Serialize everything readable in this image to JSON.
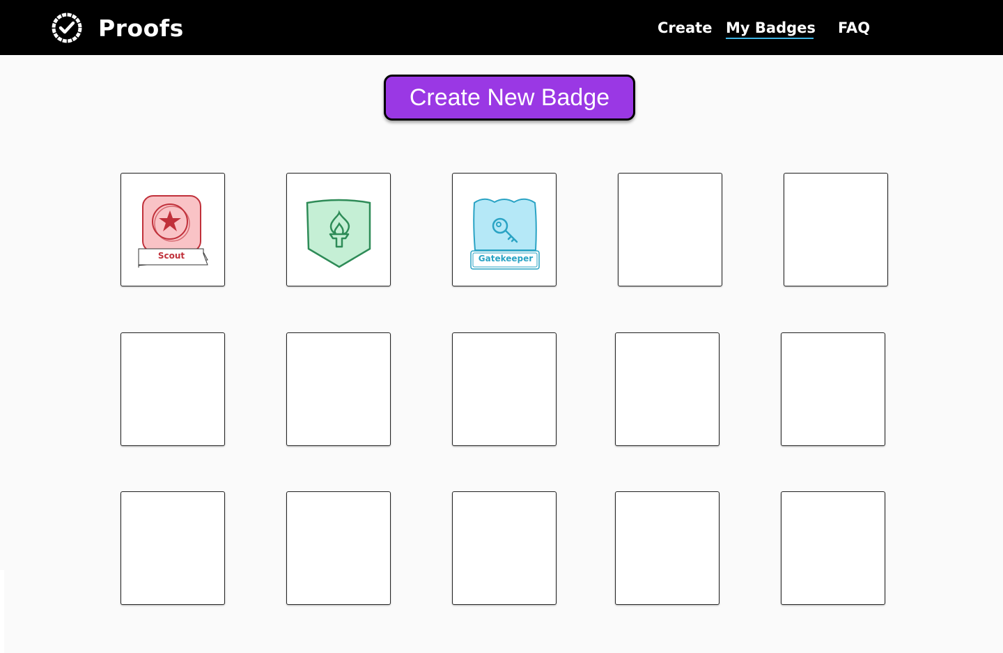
{
  "app": {
    "brand": "Proofs"
  },
  "nav": {
    "create": "Create",
    "my_badges": "My Badges",
    "faq": "FAQ",
    "active": "My Badges"
  },
  "main": {
    "create_button_label": "Create New Badge"
  },
  "badges": [
    {
      "label": "Scout",
      "icon": "star-badge-icon",
      "color": "#c0303a",
      "fill": "#f9c3c6"
    },
    {
      "label": "",
      "icon": "torch-badge-icon",
      "color": "#2e8b57",
      "fill": "#c5efd5"
    },
    {
      "label": "Gatekeeper",
      "icon": "key-badge-icon",
      "color": "#2aa3c4",
      "fill": "#b5e8f7"
    }
  ],
  "colors": {
    "navbar": "#000000",
    "accent_button": "#9a38e4",
    "nav_underline": "#3fb6e6",
    "page_background": "#fafafa"
  }
}
